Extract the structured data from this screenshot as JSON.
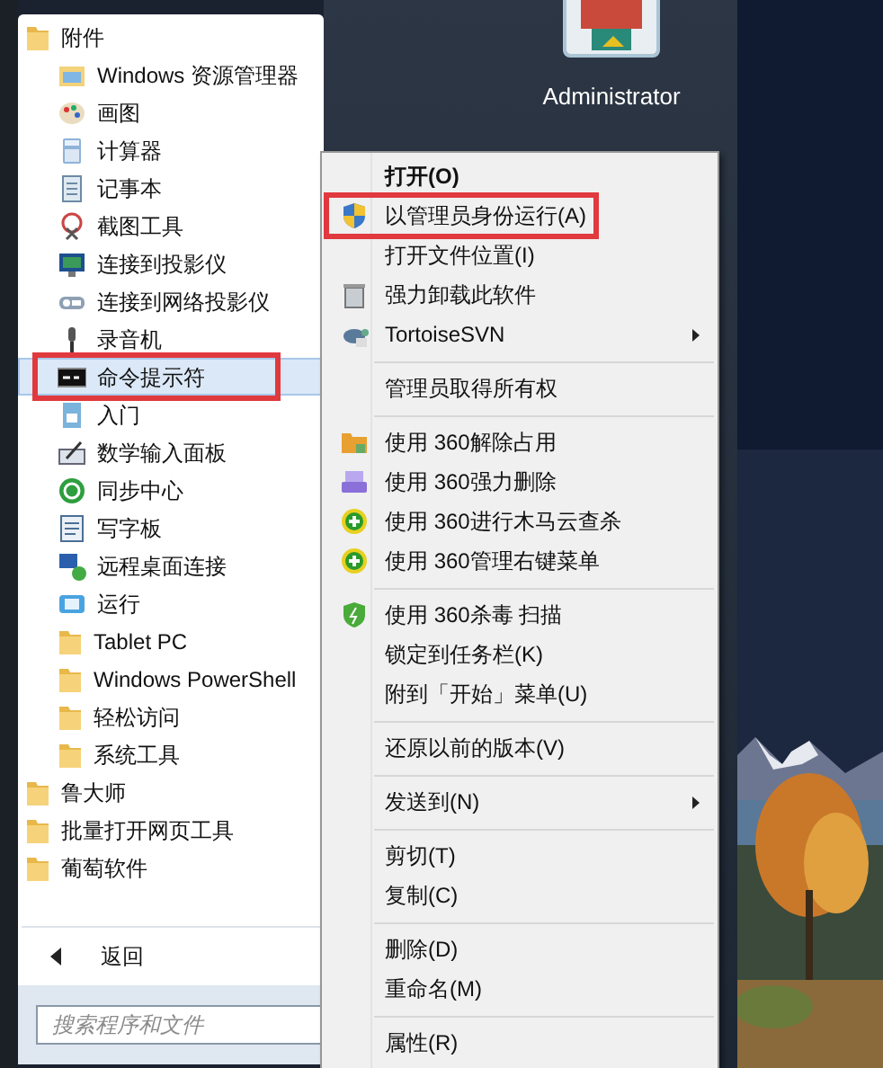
{
  "user": {
    "name": "Administrator"
  },
  "programs": [
    {
      "label": "附件",
      "kind": "folder",
      "expanded": true,
      "selected": false,
      "annotated": false,
      "children": [
        {
          "label": "Windows 资源管理器",
          "kind": "app",
          "selected": false,
          "annotated": false
        },
        {
          "label": "画图",
          "kind": "app",
          "selected": false,
          "annotated": false
        },
        {
          "label": "计算器",
          "kind": "app",
          "selected": false,
          "annotated": false
        },
        {
          "label": "记事本",
          "kind": "app",
          "selected": false,
          "annotated": false
        },
        {
          "label": "截图工具",
          "kind": "app",
          "selected": false,
          "annotated": false
        },
        {
          "label": "连接到投影仪",
          "kind": "app",
          "selected": false,
          "annotated": false
        },
        {
          "label": "连接到网络投影仪",
          "kind": "app",
          "selected": false,
          "annotated": false
        },
        {
          "label": "录音机",
          "kind": "app",
          "selected": false,
          "annotated": false
        },
        {
          "label": "命令提示符",
          "kind": "app",
          "selected": true,
          "annotated": true
        },
        {
          "label": "入门",
          "kind": "app",
          "selected": false,
          "annotated": false
        },
        {
          "label": "数学输入面板",
          "kind": "app",
          "selected": false,
          "annotated": false
        },
        {
          "label": "同步中心",
          "kind": "app",
          "selected": false,
          "annotated": false
        },
        {
          "label": "写字板",
          "kind": "app",
          "selected": false,
          "annotated": false
        },
        {
          "label": "远程桌面连接",
          "kind": "app",
          "selected": false,
          "annotated": false
        },
        {
          "label": "运行",
          "kind": "app",
          "selected": false,
          "annotated": false
        },
        {
          "label": "Tablet PC",
          "kind": "folder",
          "selected": false,
          "annotated": false
        },
        {
          "label": "Windows PowerShell",
          "kind": "folder",
          "selected": false,
          "annotated": false
        },
        {
          "label": "轻松访问",
          "kind": "folder",
          "selected": false,
          "annotated": false
        },
        {
          "label": "系统工具",
          "kind": "folder",
          "selected": false,
          "annotated": false
        }
      ]
    },
    {
      "label": "鲁大师",
      "kind": "folder",
      "expanded": false,
      "selected": false,
      "annotated": false
    },
    {
      "label": "批量打开网页工具",
      "kind": "folder",
      "expanded": false,
      "selected": false,
      "annotated": false
    },
    {
      "label": "葡萄软件",
      "kind": "folder",
      "expanded": false,
      "selected": false,
      "annotated": false
    }
  ],
  "back": {
    "label": "返回"
  },
  "search": {
    "placeholder": "搜索程序和文件"
  },
  "context_menu": [
    [
      {
        "label": "打开(O)",
        "default": true,
        "annotated": false,
        "submenu": false
      },
      {
        "label": "以管理员身份运行(A)",
        "default": false,
        "annotated": true,
        "submenu": false
      },
      {
        "label": "打开文件位置(I)",
        "default": false,
        "annotated": false,
        "submenu": false
      },
      {
        "label": "强力卸载此软件",
        "default": false,
        "annotated": false,
        "submenu": false
      },
      {
        "label": "TortoiseSVN",
        "default": false,
        "annotated": false,
        "submenu": true
      }
    ],
    [
      {
        "label": "管理员取得所有权",
        "default": false,
        "annotated": false,
        "submenu": false
      }
    ],
    [
      {
        "label": "使用 360解除占用",
        "default": false,
        "annotated": false,
        "submenu": false
      },
      {
        "label": "使用 360强力删除",
        "default": false,
        "annotated": false,
        "submenu": false
      },
      {
        "label": "使用 360进行木马云查杀",
        "default": false,
        "annotated": false,
        "submenu": false
      },
      {
        "label": "使用 360管理右键菜单",
        "default": false,
        "annotated": false,
        "submenu": false
      }
    ],
    [
      {
        "label": "使用 360杀毒 扫描",
        "default": false,
        "annotated": false,
        "submenu": false
      },
      {
        "label": "锁定到任务栏(K)",
        "default": false,
        "annotated": false,
        "submenu": false
      },
      {
        "label": "附到「开始」菜单(U)",
        "default": false,
        "annotated": false,
        "submenu": false
      }
    ],
    [
      {
        "label": "还原以前的版本(V)",
        "default": false,
        "annotated": false,
        "submenu": false
      }
    ],
    [
      {
        "label": "发送到(N)",
        "default": false,
        "annotated": false,
        "submenu": true
      }
    ],
    [
      {
        "label": "剪切(T)",
        "default": false,
        "annotated": false,
        "submenu": false
      },
      {
        "label": "复制(C)",
        "default": false,
        "annotated": false,
        "submenu": false
      }
    ],
    [
      {
        "label": "删除(D)",
        "default": false,
        "annotated": false,
        "submenu": false
      },
      {
        "label": "重命名(M)",
        "default": false,
        "annotated": false,
        "submenu": false
      }
    ],
    [
      {
        "label": "属性(R)",
        "default": false,
        "annotated": false,
        "submenu": false
      }
    ]
  ]
}
